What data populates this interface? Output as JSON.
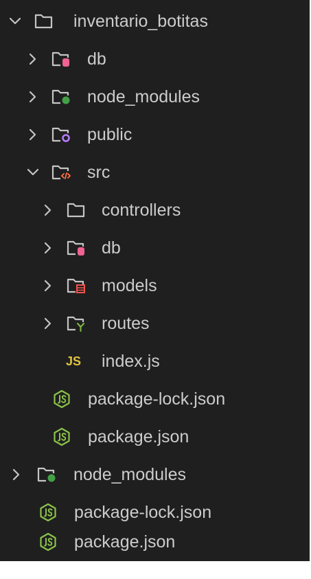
{
  "explorer": {
    "root": {
      "label": "inventario_botitas",
      "expanded": true,
      "icon": "folder-open-icon"
    },
    "items": [
      {
        "label": "db",
        "expanded": false,
        "icon": "database-folder-icon",
        "accent": "#f06292"
      },
      {
        "label": "node_modules",
        "expanded": false,
        "icon": "node-folder-icon",
        "accent": "#43a047"
      },
      {
        "label": "public",
        "expanded": false,
        "icon": "public-folder-icon",
        "accent": "#b47cff"
      },
      {
        "label": "src",
        "expanded": true,
        "icon": "source-folder-icon",
        "accent": "#ff7043"
      },
      {
        "label": "controllers",
        "expanded": false,
        "icon": "folder-icon"
      },
      {
        "label": "db",
        "expanded": false,
        "icon": "database-folder-icon",
        "accent": "#f06292"
      },
      {
        "label": "models",
        "expanded": false,
        "icon": "models-folder-icon",
        "accent": "#ef5350"
      },
      {
        "label": "routes",
        "expanded": false,
        "icon": "routes-folder-icon",
        "accent": "#7cb342"
      },
      {
        "label": "index.js",
        "icon": "javascript-icon",
        "badge": "JS",
        "accent": "#e0c341"
      },
      {
        "label": "package-lock.json",
        "icon": "nodejs-icon",
        "accent": "#8bc34a"
      },
      {
        "label": "package.json",
        "icon": "nodejs-icon",
        "accent": "#8bc34a"
      },
      {
        "label": "node_modules",
        "expanded": false,
        "icon": "node-folder-icon",
        "accent": "#43a047"
      },
      {
        "label": "package-lock.json",
        "icon": "nodejs-icon",
        "accent": "#8bc34a"
      },
      {
        "label": "package.json",
        "icon": "nodejs-icon",
        "accent": "#8bc34a"
      }
    ]
  },
  "colors": {
    "background": "#1f1f1f",
    "text": "#cccccc",
    "chevron": "#c5c5c5",
    "folder_outline": "#c5c5c5"
  }
}
